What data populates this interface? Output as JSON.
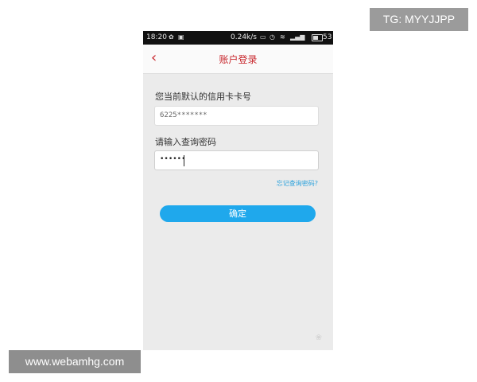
{
  "status_bar": {
    "time": "18:20",
    "net_speed": "0.24k/s",
    "battery": "53"
  },
  "nav": {
    "back_label": "‹",
    "title": "账户登录"
  },
  "form": {
    "card_label": "您当前默认的信用卡卡号",
    "card_value": "6225*******",
    "password_label": "请输入查询密码",
    "password_value": "••••••",
    "forgot_link": "忘记查询密码?",
    "confirm_button": "确定"
  },
  "watermarks": {
    "top_right": "TG: MYYJJPP",
    "bottom_left": "www.webamhg.com"
  },
  "colors": {
    "accent_red": "#c8262c",
    "button_blue": "#1fa8ec",
    "link_blue": "#2aa1dc"
  }
}
